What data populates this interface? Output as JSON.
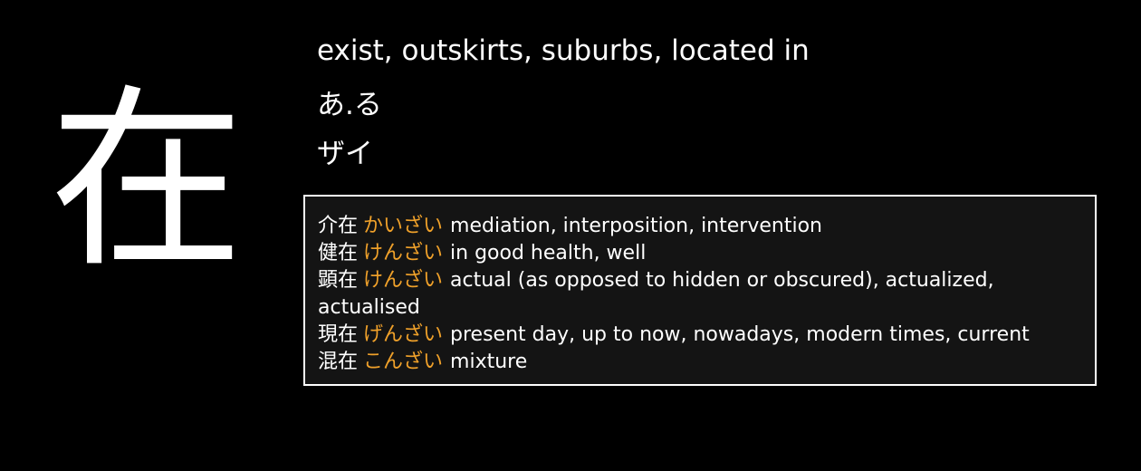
{
  "kanji": {
    "character": "在",
    "meaning": "exist, outskirts, suburbs, located in",
    "kun_reading": "あ.る",
    "on_reading": "ザイ"
  },
  "vocabulary": [
    {
      "word": "介在",
      "reading": "かいざい",
      "meaning": "mediation, interposition, intervention"
    },
    {
      "word": "健在",
      "reading": "けんざい",
      "meaning": "in good health, well"
    },
    {
      "word": "顕在",
      "reading": "けんざい",
      "meaning": "actual (as opposed to hidden or obscured), actualized, actualised"
    },
    {
      "word": "現在",
      "reading": "げんざい",
      "meaning": "present day, up to now, nowadays, modern times, current"
    },
    {
      "word": "混在",
      "reading": "こんざい",
      "meaning": "mixture"
    }
  ],
  "colors": {
    "background": "#000000",
    "panel_background": "#141414",
    "reading_accent": "#f0a12a",
    "text": "#ffffff"
  }
}
